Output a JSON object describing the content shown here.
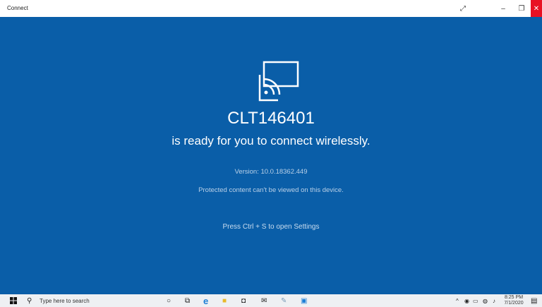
{
  "window": {
    "title": "Connect"
  },
  "main": {
    "device_name": "CLT146401",
    "ready_text": "is ready for you to connect wirelessly.",
    "version": "Version: 10.0.18362.449",
    "protected_text": "Protected content can't be viewed on this device.",
    "settings_hint": "Press Ctrl + S to open Settings"
  },
  "taskbar": {
    "search_placeholder": "Type here to search",
    "time": "8:25 PM",
    "date": "7/1/2020"
  },
  "colors": {
    "background": "#0a5ea8",
    "close": "#e81123",
    "taskbar": "#eef0f3"
  }
}
